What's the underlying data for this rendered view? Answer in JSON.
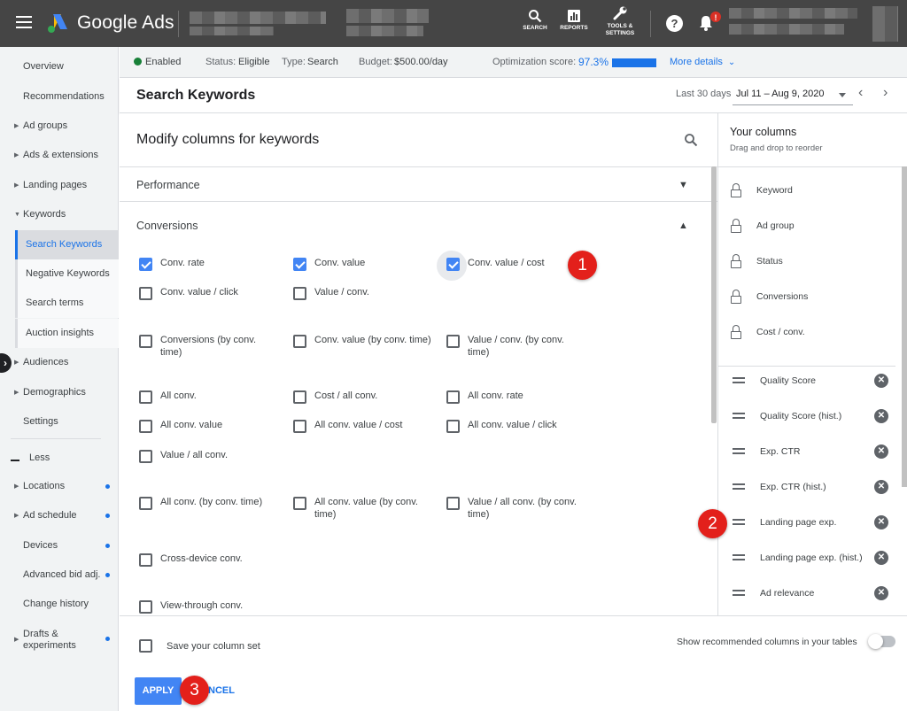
{
  "topbar": {
    "brand": "Google Ads",
    "tools": [
      {
        "label": "SEARCH"
      },
      {
        "label": "REPORTS"
      },
      {
        "label": "TOOLS &\nSETTINGS"
      }
    ],
    "help": "?",
    "notification_badge": "!"
  },
  "sidebar": {
    "items": [
      {
        "label": "Overview"
      },
      {
        "label": "Recommendations"
      },
      {
        "label": "Ad groups"
      },
      {
        "label": "Ads & extensions"
      },
      {
        "label": "Landing pages"
      },
      {
        "label": "Keywords"
      },
      {
        "label": "Search Keywords"
      },
      {
        "label": "Negative Keywords"
      },
      {
        "label": "Search terms"
      },
      {
        "label": "Auction insights"
      },
      {
        "label": "Audiences"
      },
      {
        "label": "Demographics"
      },
      {
        "label": "Settings"
      },
      {
        "label": "Less"
      },
      {
        "label": "Locations"
      },
      {
        "label": "Ad schedule"
      },
      {
        "label": "Devices"
      },
      {
        "label": "Advanced bid adj."
      },
      {
        "label": "Change history"
      },
      {
        "label": "Drafts & experiments"
      }
    ]
  },
  "status": {
    "enabled": "Enabled",
    "status_label": "Status:",
    "status_value": "Eligible",
    "type_label": "Type:",
    "type_value": "Search",
    "budget_label": "Budget:",
    "budget_value": "$500.00/day",
    "opt_label": "Optimization score:",
    "opt_value": "97.3%",
    "more": "More details"
  },
  "header": {
    "title": "Search Keywords",
    "range_label": "Last 30 days",
    "range_value": "Jul 11 – Aug 9, 2020"
  },
  "dialog": {
    "title": "Modify columns for keywords",
    "sections": [
      {
        "label": "Performance",
        "expanded": false
      },
      {
        "label": "Conversions",
        "expanded": true
      }
    ],
    "checkboxes": [
      {
        "label": "Conv. rate",
        "checked": true
      },
      {
        "label": "Conv. value",
        "checked": true
      },
      {
        "label": "Conv. value / cost",
        "checked": true
      },
      {
        "label": "Conv. value / click",
        "checked": false
      },
      {
        "label": "Value / conv.",
        "checked": false
      },
      {
        "label": "Conversions (by conv. time)",
        "checked": false
      },
      {
        "label": "Conv. value (by conv. time)",
        "checked": false
      },
      {
        "label": "Value / conv. (by conv. time)",
        "checked": false
      },
      {
        "label": "All conv.",
        "checked": false
      },
      {
        "label": "Cost / all conv.",
        "checked": false
      },
      {
        "label": "All conv. rate",
        "checked": false
      },
      {
        "label": "All conv. value",
        "checked": false
      },
      {
        "label": "All conv. value / cost",
        "checked": false
      },
      {
        "label": "All conv. value / click",
        "checked": false
      },
      {
        "label": "Value / all conv.",
        "checked": false
      },
      {
        "label": "All conv. (by conv. time)",
        "checked": false
      },
      {
        "label": "All conv. value (by conv. time)",
        "checked": false
      },
      {
        "label": "Value / all conv. (by conv. time)",
        "checked": false
      },
      {
        "label": "Cross-device conv.",
        "checked": false
      },
      {
        "label": "View-through conv.",
        "checked": false
      }
    ],
    "your_columns": {
      "title": "Your columns",
      "subtitle": "Drag and drop to reorder",
      "locked": [
        "Keyword",
        "Ad group",
        "Status",
        "Conversions",
        "Cost / conv."
      ],
      "draggable": [
        "Quality Score",
        "Quality Score (hist.)",
        "Exp. CTR",
        "Exp. CTR (hist.)",
        "Landing page exp.",
        "Landing page exp. (hist.)",
        "Ad relevance"
      ]
    },
    "save_label": "Save your column set",
    "save_checked": false,
    "recommended_label": "Show recommended columns in your tables",
    "recommended_on": false,
    "apply": "APPLY",
    "cancel": "NCEL"
  },
  "markers": [
    "1",
    "2",
    "3"
  ],
  "colors": {
    "topbar": "#454545",
    "accent": "#1a73e8",
    "checkbox": "#4285f4",
    "marker": "#e3201b"
  }
}
